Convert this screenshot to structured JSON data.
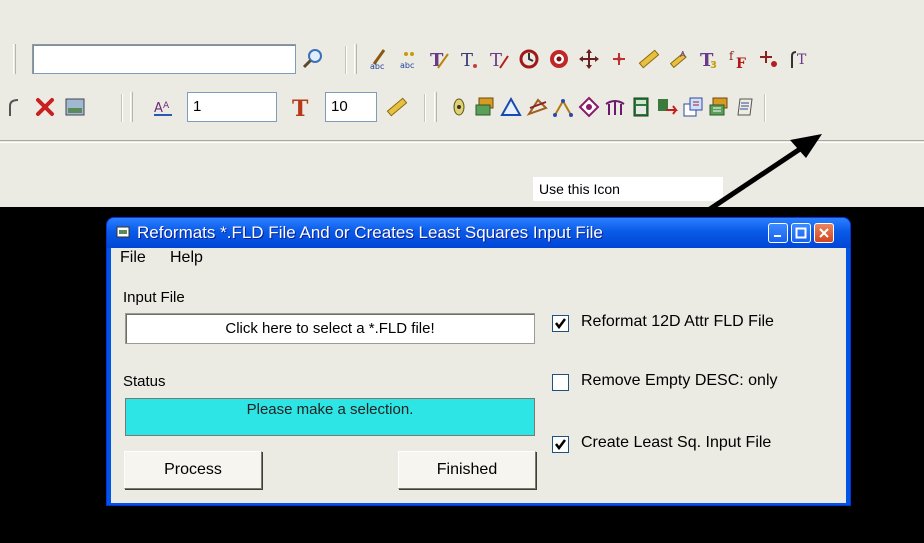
{
  "toolbar": {
    "row1_icons": [
      "search-icon",
      "text-align-icon",
      "text-abc-icon",
      "text-style-icon",
      "text-t-icon",
      "text-rotate-icon",
      "rotate-icon",
      "target-icon",
      "move-icon",
      "move-small-icon",
      "measure-icon",
      "measure-text-icon",
      "text-format-icon",
      "text-fn-icon",
      "node-icon",
      "text-attach-icon"
    ],
    "row2_icons": [
      "curve-icon",
      "delete-icon",
      "image-icon",
      "text-height-icon",
      "text-size-icon",
      "ruler-icon",
      "point-icon",
      "layers-icon",
      "triangle-icon",
      "shape-icon",
      "grid-points-icon",
      "diamond-icon",
      "bridge-icon",
      "calculator-icon",
      "export-icon",
      "reformat-icon",
      "least-squares-icon",
      "list-icon"
    ],
    "text_height_value": "1",
    "text_size_value": "10"
  },
  "hint": "Use this Icon",
  "dialog": {
    "title": "Reformats *.FLD File And or Creates Least Squares Input File",
    "menu": [
      "File",
      "Help"
    ],
    "input_file_label": "Input File",
    "input_file_prompt": "Click here to select a *.FLD  file!",
    "status_label": "Status",
    "status_text": "Please make a selection.",
    "process_button": "Process",
    "finished_button": "Finished",
    "options": [
      {
        "label": "Reformat 12D Attr FLD File",
        "checked": true
      },
      {
        "label": "Remove Empty DESC: only",
        "checked": false
      },
      {
        "label": "Create Least Sq. Input File",
        "checked": true
      }
    ]
  },
  "colors": {
    "titlebar": "#0a5ae8",
    "status_bg": "#2ee5e5",
    "toolbar_bg": "#ecebe3"
  }
}
